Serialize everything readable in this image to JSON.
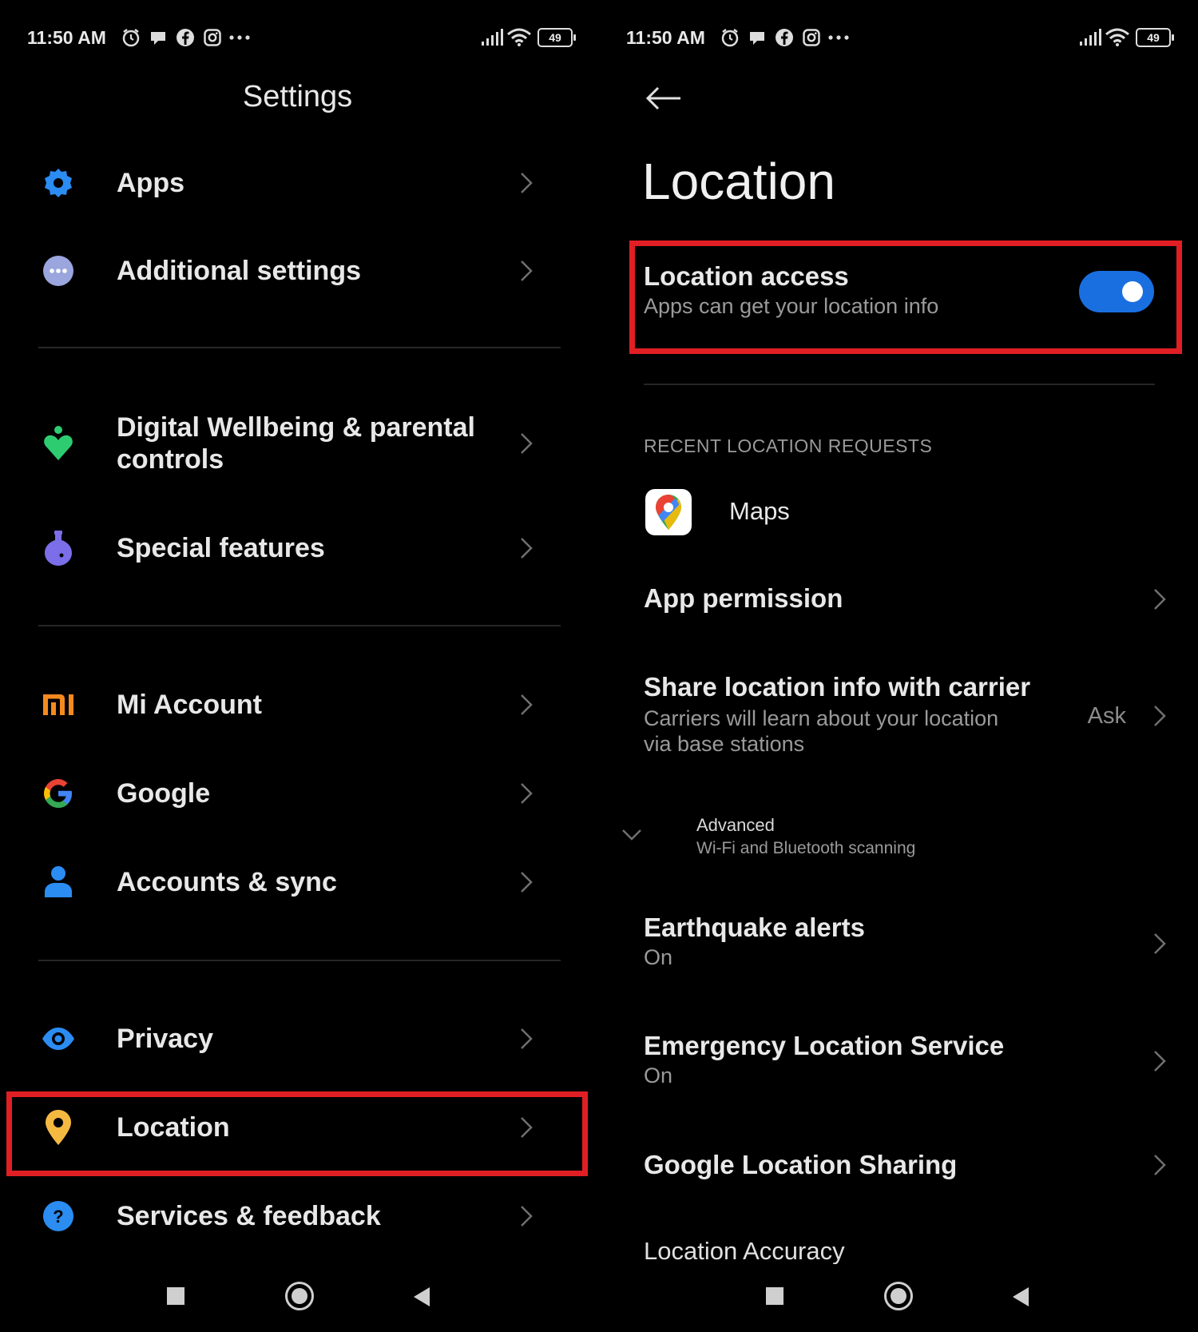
{
  "status_bar": {
    "time": "11:50 AM",
    "icons": [
      "alarm-icon",
      "chat-icon",
      "facebook-icon",
      "instagram-icon",
      "more-dots-icon"
    ],
    "right_icons": [
      "signal-icon",
      "wifi-icon"
    ],
    "battery_level": "49"
  },
  "left_screen": {
    "title": "Settings",
    "items": [
      {
        "label": "Apps",
        "icon": "gear-icon",
        "color": "#2b8cf2"
      },
      {
        "label": "Additional settings",
        "icon": "dots-circle-icon",
        "color": "#9aa6dd"
      },
      {
        "label": "Digital Wellbeing & parental controls",
        "icon": "heart-person-icon",
        "color": "#2ecc71"
      },
      {
        "label": "Special features",
        "icon": "potion-icon",
        "color": "#7b6ee8"
      },
      {
        "label": "Mi Account",
        "icon": "mi-logo-icon",
        "color": "#f58a1f"
      },
      {
        "label": "Google",
        "icon": "google-logo-icon",
        "color": "#4285f4"
      },
      {
        "label": "Accounts & sync",
        "icon": "person-icon",
        "color": "#2b8cf2"
      },
      {
        "label": "Privacy",
        "icon": "eye-icon",
        "color": "#2b8cf2"
      },
      {
        "label": "Location",
        "icon": "location-pin-icon",
        "color": "#f5b942"
      },
      {
        "label": "Services & feedback",
        "icon": "question-circle-icon",
        "color": "#2b8cf2"
      }
    ],
    "highlighted_item": "Location"
  },
  "right_screen": {
    "title": "Location",
    "location_access": {
      "title": "Location access",
      "subtitle": "Apps can get your location info",
      "enabled": true
    },
    "recent_header": "RECENT LOCATION REQUESTS",
    "recent_apps": [
      {
        "name": "Maps",
        "icon": "google-maps-icon"
      }
    ],
    "app_permission": "App permission",
    "share_carrier": {
      "title": "Share location info with carrier",
      "subtitle": "Carriers will learn about your location via base stations",
      "value": "Ask"
    },
    "advanced": {
      "title": "Advanced",
      "subtitle": "Wi-Fi and Bluetooth scanning"
    },
    "earthquake": {
      "title": "Earthquake alerts",
      "value": "On"
    },
    "emergency": {
      "title": "Emergency Location Service",
      "value": "On"
    },
    "google_sharing": "Google Location Sharing",
    "accuracy": "Location Accuracy"
  },
  "colors": {
    "highlight_border": "#e01f24",
    "toggle_on": "#1a6fe0",
    "background": "#000000"
  },
  "nav_bar": [
    "recents-square-icon",
    "home-circle-icon",
    "back-triangle-icon"
  ]
}
